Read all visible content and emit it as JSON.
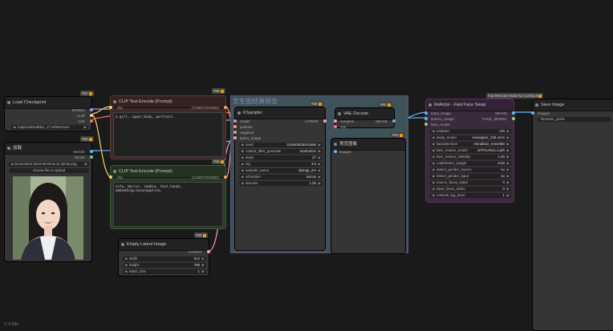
{
  "load_checkpoint": {
    "badge": "#57",
    "title": "Load Checkpoint",
    "out_model": "MODEL",
    "out_clip": "CLIP",
    "out_vae": "VAE",
    "ckpt_value": "majicmixRealistic_v7.safetensors"
  },
  "load_image": {
    "badge": "#50",
    "title": "加载",
    "out_image": "IMAGE",
    "out_mask": "MASK",
    "image_value": "Screenshot 2024-05-09 at 21.30.55.png",
    "upload_label": "choose file to upload"
  },
  "clip_pos": {
    "badge": "#58",
    "title": "CLIP Text Encode (Prompt)",
    "in_clip": "clip",
    "out_cond": "CONDITIONING",
    "text": "a girl, upper_body, portrait,"
  },
  "clip_neg": {
    "badge": "#56",
    "title": "CLIP Text Encode (Prompt)",
    "in_clip": "clip",
    "out_cond": "CONDITIONING",
    "text": "nsfw, Horror, zombie, text,hands, embedding:easynegative,"
  },
  "empty_latent": {
    "badge": "#53",
    "title": "Empty Latent Image",
    "out_latent": "LATENT",
    "width_label": "width",
    "width_value": "512",
    "height_label": "height",
    "height_value": "768",
    "batch_label": "batch_size",
    "batch_value": "1"
  },
  "group": {
    "title": "文生图结果预览"
  },
  "ksampler": {
    "badge": "#55",
    "title": "KSampler",
    "in_model": "model",
    "in_positive": "positive",
    "in_negative": "negative",
    "in_latent": "latent_image",
    "out_latent": "LATENT",
    "widgets": [
      {
        "label": "seed",
        "value": "242562825041866"
      },
      {
        "label": "control_after_generate",
        "value": "randomize"
      },
      {
        "label": "steps",
        "value": "27"
      },
      {
        "label": "cfg",
        "value": "3.0"
      },
      {
        "label": "sampler_name",
        "value": "dpmpp_2m"
      },
      {
        "label": "scheduler",
        "value": "karras"
      },
      {
        "label": "denoise",
        "value": "1.00"
      }
    ]
  },
  "vae_decode": {
    "badge": "#60",
    "title": "VAE Decode",
    "in_samples": "samples",
    "in_vae": "vae",
    "out_image": "IMAGE"
  },
  "preview": {
    "badge": "#62",
    "title": "预览图像",
    "in_images": "images"
  },
  "reactor": {
    "badge": "#43",
    "badge_title": "ReActor Node for ComfyUI",
    "title": "ReActor - Fast Face Swap",
    "in_input_image": "input_image",
    "in_source_image": "source_image",
    "in_face_model": "face_model",
    "out_image": "IMAGE",
    "out_face_model": "FACE_MODEL",
    "widgets": [
      {
        "label": "enabled",
        "value": "ON"
      },
      {
        "label": "swap_model",
        "value": "inswapper_128.onnx"
      },
      {
        "label": "facedetection",
        "value": "retinaface_resnet50"
      },
      {
        "label": "face_restore_model",
        "value": "GFPGANv1.4.pth"
      },
      {
        "label": "face_restore_visibility",
        "value": "1.00"
      },
      {
        "label": "codeformer_weight",
        "value": "0.60"
      },
      {
        "label": "detect_gender_source",
        "value": "no"
      },
      {
        "label": "detect_gender_input",
        "value": "no"
      },
      {
        "label": "source_faces_index",
        "value": "0"
      },
      {
        "label": "input_faces_index",
        "value": "0"
      },
      {
        "label": "console_log_level",
        "value": "1"
      }
    ]
  },
  "save_image": {
    "title": "Save Image",
    "in_images": "images",
    "prefix_value": "filename_prefix"
  },
  "status": {
    "time": "7: 0.00s"
  },
  "colors": {
    "clip": "#f2d66e",
    "model": "#b19cd9",
    "cond": "#ffa06a",
    "latent": "#ff9ccd",
    "vae": "#ff6e6e",
    "image": "#64b5f6",
    "mask": "#81c784"
  }
}
